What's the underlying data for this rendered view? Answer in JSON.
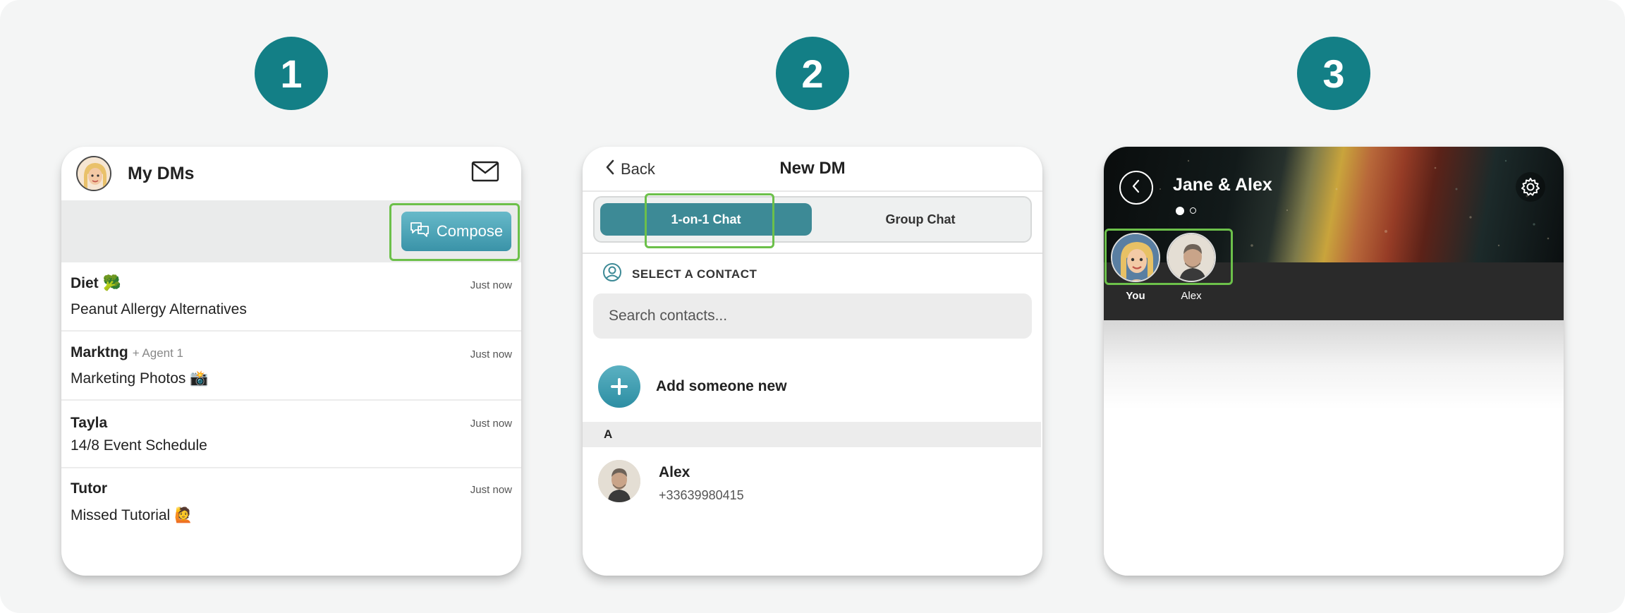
{
  "steps": [
    "1",
    "2",
    "3"
  ],
  "card1": {
    "title": "My DMs",
    "compose_label": "Compose",
    "dms": [
      {
        "name": "Diet 🥦",
        "agent": "",
        "time": "Just now",
        "subtitle": "Peanut Allergy Alternatives"
      },
      {
        "name": "Marktng",
        "agent": "+ Agent 1",
        "time": "Just now",
        "subtitle": "Marketing Photos 📸"
      },
      {
        "name": "Tayla",
        "agent": "",
        "time": "Just now",
        "subtitle": "14/8 Event Schedule"
      },
      {
        "name": "Tutor",
        "agent": "",
        "time": "Just now",
        "subtitle": "Missed Tutorial 🙋"
      }
    ]
  },
  "card2": {
    "back_label": "Back",
    "title": "New DM",
    "tab_active": "1-on-1 Chat",
    "tab_inactive": "Group Chat",
    "section_label": "SELECT A CONTACT",
    "search_placeholder": "Search contacts...",
    "add_label": "Add someone new",
    "index_letter": "A",
    "contact": {
      "name": "Alex",
      "phone": "+33639980415"
    }
  },
  "card3": {
    "title": "Jane & Alex",
    "participants": [
      {
        "label": "You"
      },
      {
        "label": "Alex"
      }
    ]
  },
  "colors": {
    "teal_badge": "#137f86",
    "highlight_green": "#6cc04a",
    "segment_active": "#3d8a96",
    "compose_button": "#4aa3b6"
  }
}
